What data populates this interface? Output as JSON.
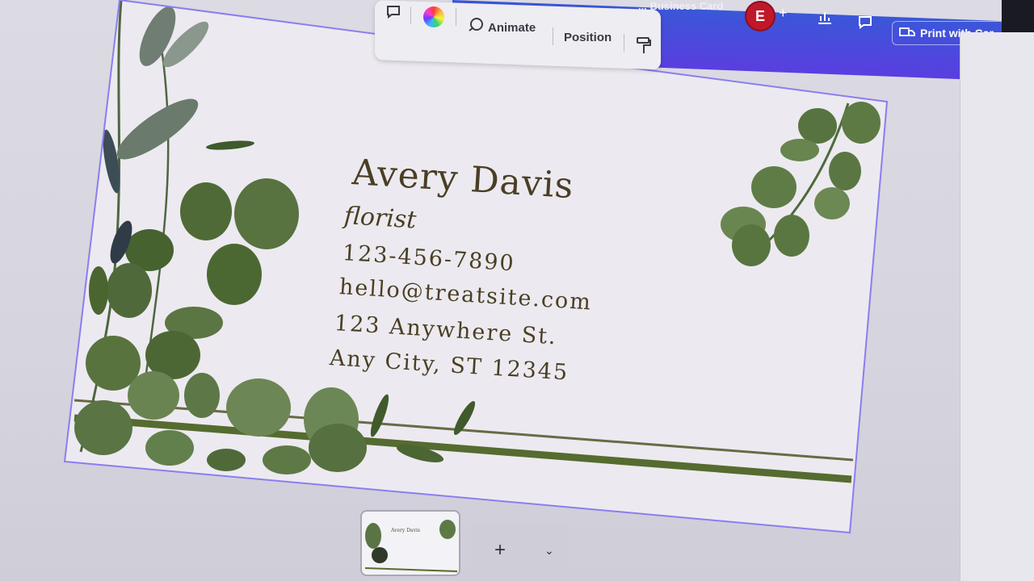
{
  "header": {
    "doc_title": "... Business Card",
    "avatar_initial": "E",
    "add_icon": "plus-icon",
    "print_label": "Print with Car"
  },
  "toolbar": {
    "animate_label": "Animate",
    "position_label": "Position"
  },
  "card": {
    "name": "Avery Davis",
    "role": "florist",
    "phone": "123-456-7890",
    "email": "hello@treatsite.com",
    "address_line1": "123 Anywhere St.",
    "address_line2": "Any City, ST 12345",
    "accent_color": "#556b2f",
    "text_color": "#4a3f24"
  },
  "pages": {
    "add_label": "+",
    "thumbnail_text": "Avery Davis"
  },
  "colors": {
    "topbar": "#4a4fdc",
    "avatar": "#c0182a",
    "selection": "#8a7ef0"
  }
}
